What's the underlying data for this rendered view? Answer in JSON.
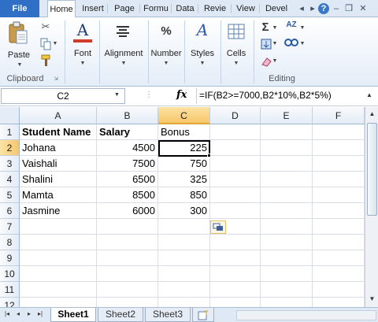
{
  "tabs": [
    {
      "label": "File"
    },
    {
      "label": "Home"
    },
    {
      "label": "Insert"
    },
    {
      "label": "Page"
    },
    {
      "label": "Formu"
    },
    {
      "label": "Data"
    },
    {
      "label": "Revie"
    },
    {
      "label": "View"
    },
    {
      "label": "Devel"
    }
  ],
  "ribbon": {
    "paste": "Paste",
    "font": "Font",
    "alignment": "Alignment",
    "number": "Number",
    "styles": "Styles",
    "cells": "Cells",
    "clipboard_group": "Clipboard",
    "editing_group": "Editing",
    "icons": {
      "font": "A",
      "number": "%",
      "styles": "A",
      "sigma": "Σ",
      "sort": "AZ"
    }
  },
  "formula_bar": {
    "name_box": "C2",
    "fx": "fx",
    "formula": "=IF(B2>=7000,B2*10%,B2*5%)"
  },
  "grid": {
    "columns": [
      "A",
      "B",
      "C",
      "D",
      "E",
      "F"
    ],
    "rows": [
      "1",
      "2",
      "3",
      "4",
      "5",
      "6",
      "7",
      "8",
      "9",
      "10",
      "11",
      "12"
    ],
    "selected_column": "C",
    "selected_row": "2",
    "data": [
      [
        "Student Name",
        "Salary",
        "Bonus"
      ],
      [
        "Johana",
        "4500",
        "225"
      ],
      [
        "Vaishali",
        "7500",
        "750"
      ],
      [
        "Shalini",
        "6500",
        "325"
      ],
      [
        "Mamta",
        "8500",
        "850"
      ],
      [
        "Jasmine",
        "6000",
        "300"
      ]
    ]
  },
  "sheets": [
    {
      "label": "Sheet1",
      "active": true
    },
    {
      "label": "Sheet2",
      "active": false
    },
    {
      "label": "Sheet3",
      "active": false
    }
  ]
}
